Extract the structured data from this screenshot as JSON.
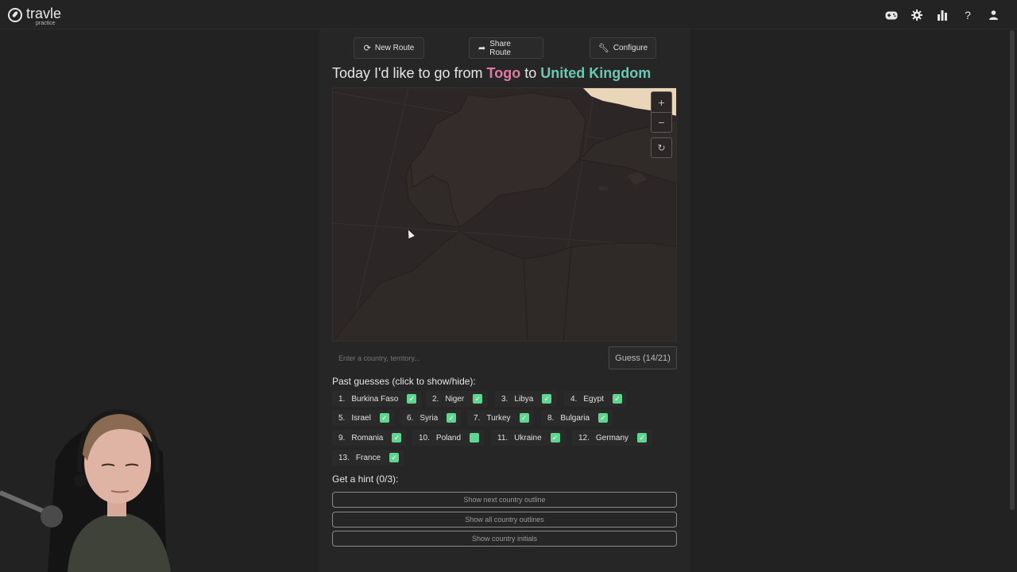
{
  "app": {
    "name": "travle",
    "mode": "practice"
  },
  "topbar": {
    "icons": [
      "gamepad-icon",
      "gear-icon",
      "stats-icon",
      "help-icon",
      "user-icon"
    ]
  },
  "toolbar": {
    "new_route": "New Route",
    "share_route": "Share Route",
    "configure": "Configure"
  },
  "headline": {
    "prefix": "Today I'd like to go from",
    "from": "Togo",
    "middle": "to",
    "to": "United Kingdom"
  },
  "map": {
    "zoom_in": "+",
    "zoom_out": "−",
    "reset": "↻"
  },
  "guess": {
    "placeholder": "Enter a country, territory...",
    "button_label": "Guess (14/21)"
  },
  "past_guesses": {
    "title": "Past guesses (click to show/hide):",
    "items": [
      {
        "num": "1.",
        "name": "Burkina Faso",
        "checked": true
      },
      {
        "num": "2.",
        "name": "Niger",
        "checked": true
      },
      {
        "num": "3.",
        "name": "Libya",
        "checked": true
      },
      {
        "num": "4.",
        "name": "Egypt",
        "checked": true
      },
      {
        "num": "5.",
        "name": "Israel",
        "checked": true
      },
      {
        "num": "6.",
        "name": "Syria",
        "checked": true
      },
      {
        "num": "7.",
        "name": "Turkey",
        "checked": true
      },
      {
        "num": "8.",
        "name": "Bulgaria",
        "checked": true
      },
      {
        "num": "9.",
        "name": "Romania",
        "checked": true
      },
      {
        "num": "10.",
        "name": "Poland",
        "checked": false
      },
      {
        "num": "11.",
        "name": "Ukraine",
        "checked": true
      },
      {
        "num": "12.",
        "name": "Germany",
        "checked": true
      },
      {
        "num": "13.",
        "name": "France",
        "checked": true
      }
    ]
  },
  "hints": {
    "title": "Get a hint (0/3):",
    "buttons": [
      "Show next country outline",
      "Show all country outlines",
      "Show country initials"
    ]
  },
  "colors": {
    "from_country": "#e07aa3",
    "to_country": "#6cc8b5",
    "check": "#5fd58f"
  }
}
